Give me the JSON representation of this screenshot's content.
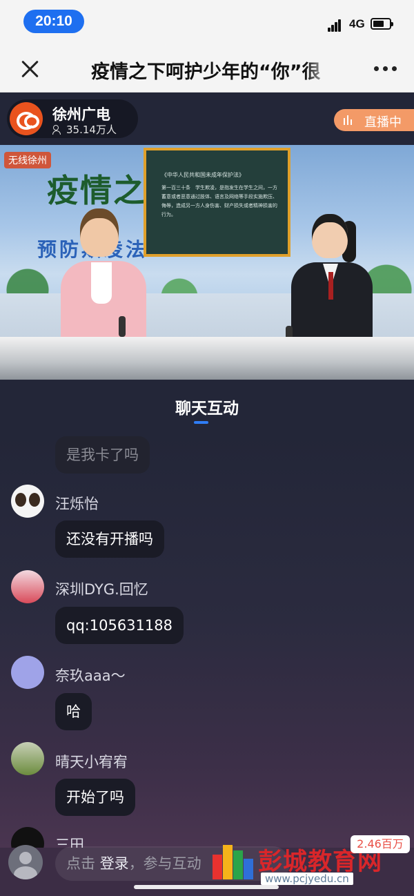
{
  "status_bar": {
    "time": "20:10",
    "network": "4G"
  },
  "title_bar": {
    "title": "疫情之下呵护少年的“你”很"
  },
  "live_header": {
    "channel_name": "徐州广电",
    "viewers": "35.14万人",
    "live_badge": "直播中"
  },
  "video": {
    "board_title": "《中华人民共和国未成年保护法》",
    "board_text": "第一百三十条　学生欺凌，是指发生在学生之间，一方蓄意或者恶意通过肢体、语言及网络等手段实施欺压、侮辱，造成另一方人身伤害、财产损失或者精神损害的行为。",
    "stage_title": "疫情之下",
    "stage_subtitle": "预防欺凌法"
  },
  "chat": {
    "title": "聊天互动",
    "messages": [
      {
        "user": "",
        "text": "是我卡了吗"
      },
      {
        "user": "汪烁怡",
        "text": "还没有开播吗"
      },
      {
        "user": "深圳DYG.回忆",
        "text": "qq:105631188"
      },
      {
        "user": "奈玖aaa～",
        "text": "哈"
      },
      {
        "user": "晴天小宥宥",
        "text": "开始了吗"
      },
      {
        "user": "三田",
        "text": ""
      }
    ]
  },
  "input_bar": {
    "placeholder_prefix": "点击",
    "placeholder_login": "登录",
    "placeholder_suffix": "，参与互动",
    "like_count": "2.46百万"
  },
  "watermark": {
    "name": "彭城教育网",
    "url": "www.pcjyedu.cn"
  }
}
